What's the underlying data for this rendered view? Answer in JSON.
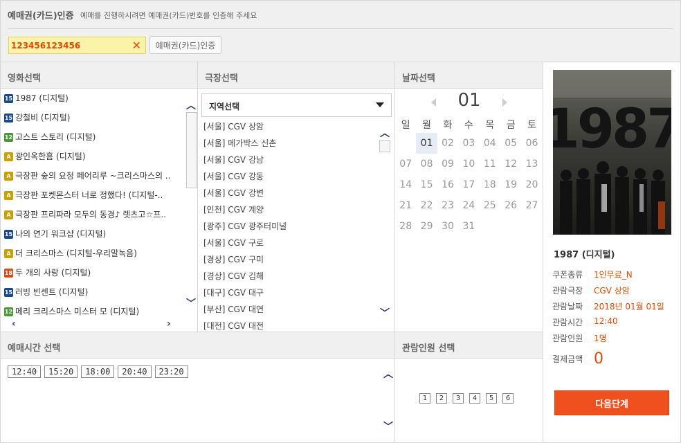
{
  "coupon": {
    "title": "예매권(카드)인증",
    "description": "예매를 진행하시려면 예매권(카드)번호를 인증해 주세요",
    "code_value": "123456123456",
    "auth_button": "예매권(카드)인증"
  },
  "movie_panel": {
    "title": "영화선택",
    "movies": [
      {
        "rating": "15",
        "title": "1987 (디지털)"
      },
      {
        "rating": "15",
        "title": "강철비 (디지털)"
      },
      {
        "rating": "12",
        "title": "고스트 스토리 (디지털)"
      },
      {
        "rating": "A",
        "title": "광인옥한흠 (디지털)"
      },
      {
        "rating": "A",
        "title": "극장판 숲의 요정 페어리루 ~크리스마스의 .."
      },
      {
        "rating": "A",
        "title": "극장판 포켓몬스터 너로 정했다! (디지털-.."
      },
      {
        "rating": "A",
        "title": "극장판 프리파라 모두의 동경♪ 렛츠고☆프.."
      },
      {
        "rating": "15",
        "title": "나의 연기 워크샵 (디지털)"
      },
      {
        "rating": "A",
        "title": "더 크리스마스 (디지털-우리말녹음)"
      },
      {
        "rating": "18",
        "title": "두 개의 사랑 (디지털)"
      },
      {
        "rating": "15",
        "title": "러빙 빈센트 (디지털)"
      },
      {
        "rating": "12",
        "title": "메리 크리스마스 미스터 모 (디지털)"
      }
    ]
  },
  "theater_panel": {
    "title": "극장선택",
    "region_select": "지역선택",
    "theaters": [
      "[서울] CGV 상암",
      "[서울] 메가박스 신촌",
      "[서울] CGV 강남",
      "[서울] CGV 강동",
      "[서울] CGV 강변",
      "[인천] CGV 계양",
      "[광주] CGV 광주터미널",
      "[서울] CGV 구로",
      "[경상] CGV 구미",
      "[경상] CGV 김해",
      "[대구] CGV 대구",
      "[부산] CGV 대연",
      "[대전] CGV 대전"
    ]
  },
  "date_panel": {
    "title": "날짜선택",
    "month": "01",
    "weekdays": [
      "일",
      "월",
      "화",
      "수",
      "목",
      "금",
      "토"
    ],
    "weeks": [
      [
        "",
        "01",
        "02",
        "03",
        "04",
        "05",
        "06"
      ],
      [
        "07",
        "08",
        "09",
        "10",
        "11",
        "12",
        "13"
      ],
      [
        "14",
        "15",
        "16",
        "17",
        "18",
        "19",
        "20"
      ],
      [
        "21",
        "22",
        "23",
        "24",
        "25",
        "26",
        "27"
      ],
      [
        "28",
        "29",
        "30",
        "31",
        "",
        "",
        ""
      ]
    ],
    "selected_day": "01"
  },
  "showtime_panel": {
    "title": "예매시간 선택",
    "times": [
      "12:40",
      "15:20",
      "18:00",
      "20:40",
      "23:20"
    ]
  },
  "people_panel": {
    "title": "관람인원 선택",
    "counts": [
      "1",
      "2",
      "3",
      "4",
      "5",
      "6"
    ]
  },
  "summary": {
    "poster_text": "1987",
    "movie_title": "1987 (디지털)",
    "rows": [
      {
        "key": "쿠폰종류",
        "value": "1인무료_N"
      },
      {
        "key": "관람극장",
        "value": "CGV 상암"
      },
      {
        "key": "관람날짜",
        "value": "2018년 01월 01일"
      },
      {
        "key": "관람시간",
        "value": "12:40"
      },
      {
        "key": "관람인원",
        "value": "1명"
      }
    ],
    "total_label": "결제금액",
    "total_value": "0",
    "next_button": "다음단계"
  },
  "colors": {
    "accent": "#f0501e",
    "value_text": "#e04a00",
    "input_bg": "#fbf3a9"
  }
}
